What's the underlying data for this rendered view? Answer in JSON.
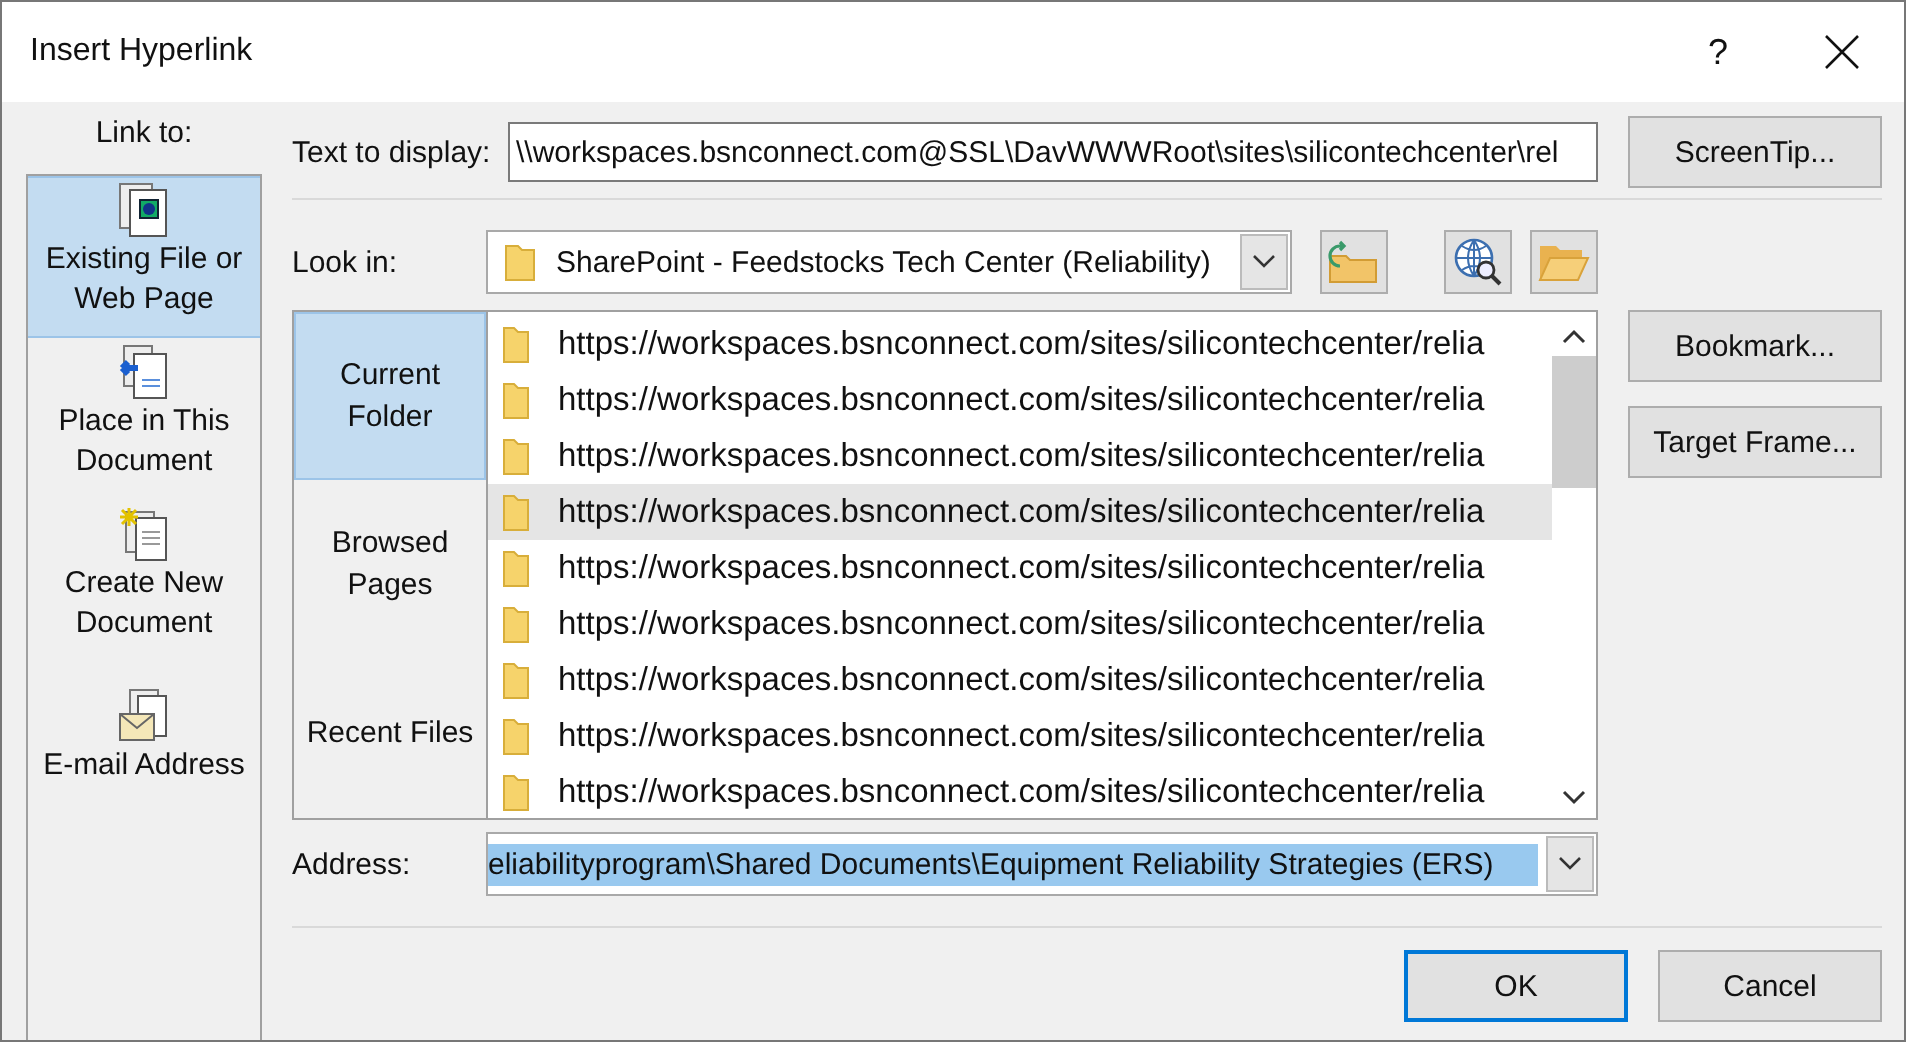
{
  "window": {
    "title": "Insert Hyperlink",
    "help_label": "?"
  },
  "link_to": {
    "label": "Link to:",
    "items": [
      {
        "label": "Existing File or Web Page",
        "kind": "file",
        "selected": true
      },
      {
        "label": "Place in This Document",
        "kind": "place",
        "selected": false
      },
      {
        "label": "Create New Document",
        "kind": "new",
        "selected": false
      },
      {
        "label": "E-mail Address",
        "kind": "email",
        "selected": false
      }
    ]
  },
  "text_to_display": {
    "label": "Text to display:",
    "value": "\\\\workspaces.bsnconnect.com@SSL\\DavWWWRoot\\sites\\silicontechcenter\\rel"
  },
  "screentip_button": "ScreenTip...",
  "look_in": {
    "label": "Look in:",
    "value": "SharePoint - Feedstocks Tech Center (Reliability)"
  },
  "nav": [
    {
      "label": "Current Folder",
      "selected": true
    },
    {
      "label": "Browsed Pages",
      "selected": false
    },
    {
      "label": "Recent Files",
      "selected": false
    }
  ],
  "files": [
    {
      "name": "https://workspaces.bsnconnect.com/sites/silicontechcenter/relia",
      "selected": false
    },
    {
      "name": "https://workspaces.bsnconnect.com/sites/silicontechcenter/relia",
      "selected": false
    },
    {
      "name": "https://workspaces.bsnconnect.com/sites/silicontechcenter/relia",
      "selected": false
    },
    {
      "name": "https://workspaces.bsnconnect.com/sites/silicontechcenter/relia",
      "selected": true
    },
    {
      "name": "https://workspaces.bsnconnect.com/sites/silicontechcenter/relia",
      "selected": false
    },
    {
      "name": "https://workspaces.bsnconnect.com/sites/silicontechcenter/relia",
      "selected": false
    },
    {
      "name": "https://workspaces.bsnconnect.com/sites/silicontechcenter/relia",
      "selected": false
    },
    {
      "name": "https://workspaces.bsnconnect.com/sites/silicontechcenter/relia",
      "selected": false
    },
    {
      "name": "https://workspaces.bsnconnect.com/sites/silicontechcenter/relia",
      "selected": false
    }
  ],
  "side_buttons": [
    "Bookmark...",
    "Target Frame..."
  ],
  "address": {
    "label": "Address:",
    "value": "eliabilityprogram\\Shared Documents\\Equipment Reliability Strategies (ERS)",
    "text_selected": true
  },
  "buttons": [
    {
      "label": "OK",
      "default": true
    },
    {
      "label": "Cancel",
      "default": false
    }
  ]
}
